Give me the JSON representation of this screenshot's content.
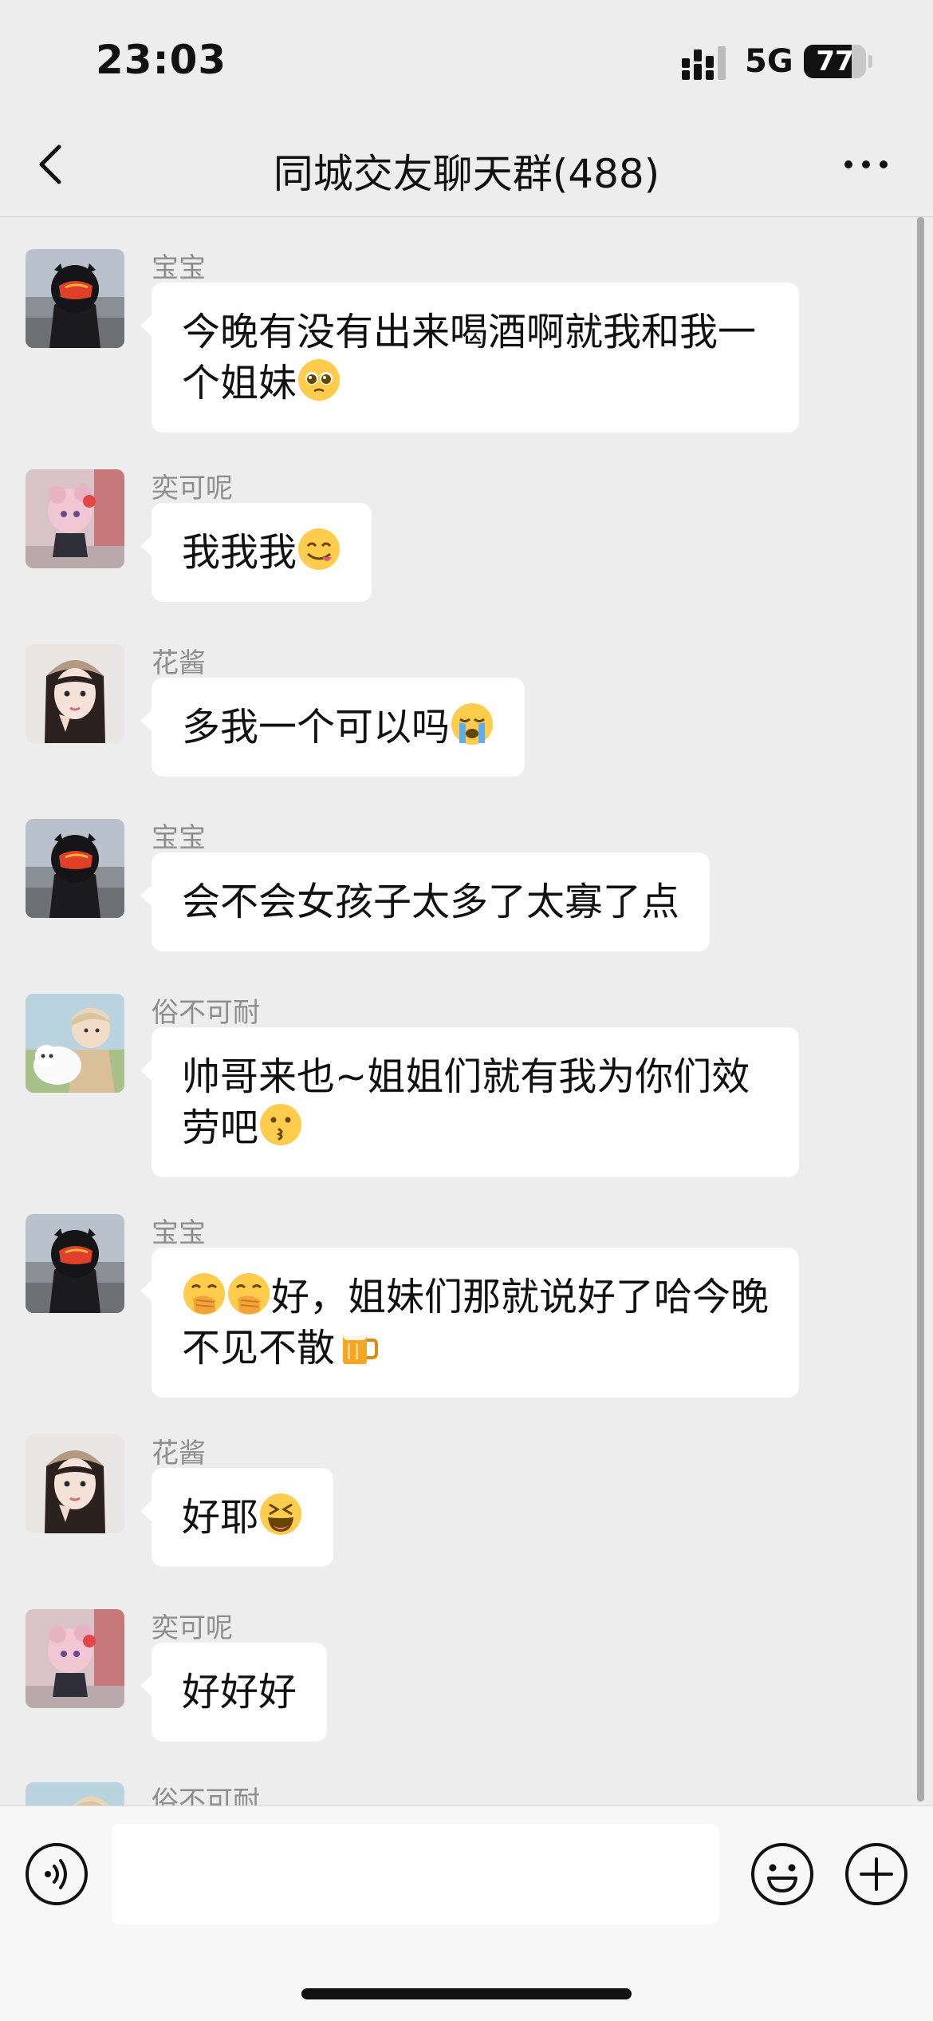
{
  "status_bar": {
    "time": "23:03",
    "network": "5G",
    "battery": "77",
    "battery_level": 0.77
  },
  "header": {
    "title": "同城交友聊天群(488)",
    "back_icon": "chevron-left-icon",
    "more_icon": "more-dots-icon"
  },
  "messages": [
    {
      "sender": "宝宝",
      "avatar": "helmet-rider-avatar",
      "text": "今晚有没有出来喝酒啊就我和我一个姐妹",
      "emoji_after": [
        "pleading-face-emoji"
      ]
    },
    {
      "sender": "奕可呢",
      "avatar": "anime-pink-hair-avatar",
      "text": "我我我",
      "emoji_after": [
        "yum-face-emoji"
      ]
    },
    {
      "sender": "花酱",
      "avatar": "girl-photo-avatar",
      "text": "多我一个可以吗",
      "emoji_after": [
        "crying-face-emoji"
      ]
    },
    {
      "sender": "宝宝",
      "avatar": "helmet-rider-avatar",
      "text": "会不会女孩子太多了太寡了点",
      "emoji_after": []
    },
    {
      "sender": "俗不可耐",
      "avatar": "anime-boy-sheep-avatar",
      "text": "帅哥来也~姐姐们就有我为你们效劳吧",
      "emoji_after": [
        "kissing-face-emoji"
      ]
    },
    {
      "sender": "宝宝",
      "avatar": "helmet-rider-avatar",
      "emoji_before": [
        "hand-over-mouth-emoji",
        "hand-over-mouth-emoji"
      ],
      "text": "好，姐妹们那就说好了哈今晚不见不散",
      "emoji_after": [
        "beer-mug-emoji"
      ]
    },
    {
      "sender": "花酱",
      "avatar": "girl-photo-avatar",
      "text": "好耶",
      "emoji_after": [
        "laughing-squint-emoji"
      ]
    },
    {
      "sender": "奕可呢",
      "avatar": "anime-pink-hair-avatar",
      "text": "好好好",
      "emoji_after": []
    },
    {
      "sender": "俗不可耐",
      "avatar": "anime-boy-sheep-avatar",
      "text": "",
      "emoji_after": []
    }
  ],
  "input_bar": {
    "placeholder": "",
    "voice_icon": "voice-icon",
    "emoji_icon": "smiley-icon",
    "add_icon": "plus-circle-icon"
  },
  "colors": {
    "background": "#ededed",
    "bubble": "#ffffff",
    "sender_name": "#8e8e8e",
    "input_bar": "#f7f7f7"
  }
}
